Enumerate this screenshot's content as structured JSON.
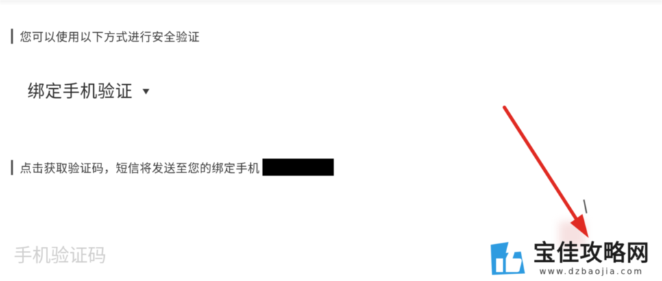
{
  "verify": {
    "method_hint": "您可以使用以下方式进行安全验证",
    "method_selected": "绑定手机验证",
    "sms_hint": "点击获取验证码，短信将发送至您的绑定手机",
    "code_input_placeholder": "手机验证码",
    "code_input_value": ""
  },
  "watermark": {
    "name": "宝佳攻略网",
    "domain": "www.dzbaojia.com"
  },
  "colors": {
    "arrow": "#e02a22",
    "logo_blue": "#2e9be0",
    "text_dark": "#2f2f2f",
    "placeholder": "#cfcfcf"
  },
  "icons": {
    "method_dropdown": "caret-down-icon",
    "annotation": "red-arrow-icon",
    "brand_logo": "thumbs-up-logo-icon"
  }
}
